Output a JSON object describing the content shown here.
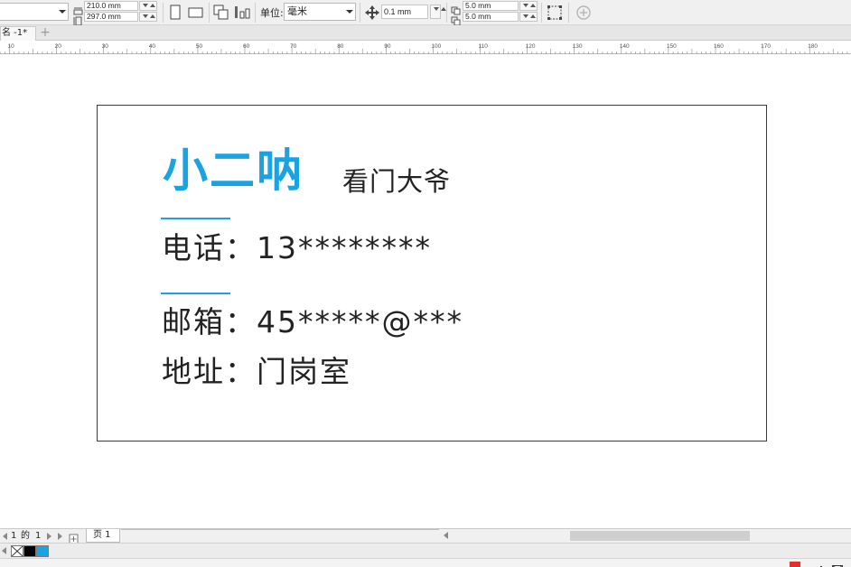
{
  "propbar": {
    "page_width": "210.0 mm",
    "page_height": "297.0 mm",
    "units_label": "单位:",
    "units_value": "毫米",
    "nudge_value": "0.1 mm",
    "dup_x": "5.0 mm",
    "dup_y": "5.0 mm"
  },
  "tabs": {
    "document_tab_label": "名 -1*",
    "add_tab_symbol": "+"
  },
  "ruler": {
    "labels": [
      "10",
      "20",
      "30",
      "40",
      "50",
      "60",
      "70",
      "80",
      "90",
      "100",
      "110",
      "120",
      "130",
      "140",
      "150",
      "160",
      "170",
      "180"
    ]
  },
  "card": {
    "name": "小二呐",
    "role": "看门大爷",
    "phone_line": "电话：13********",
    "email_line": "邮箱：45*****@***",
    "address_line": "地址：门岗室",
    "accent_color": "#1aa3e0"
  },
  "pagenav": {
    "current_page": "1",
    "of_label": "的",
    "total_pages": "1",
    "page_tab_label": "页 1"
  },
  "palette": {
    "swatches": [
      "#000000",
      "#1aa3e0"
    ]
  }
}
